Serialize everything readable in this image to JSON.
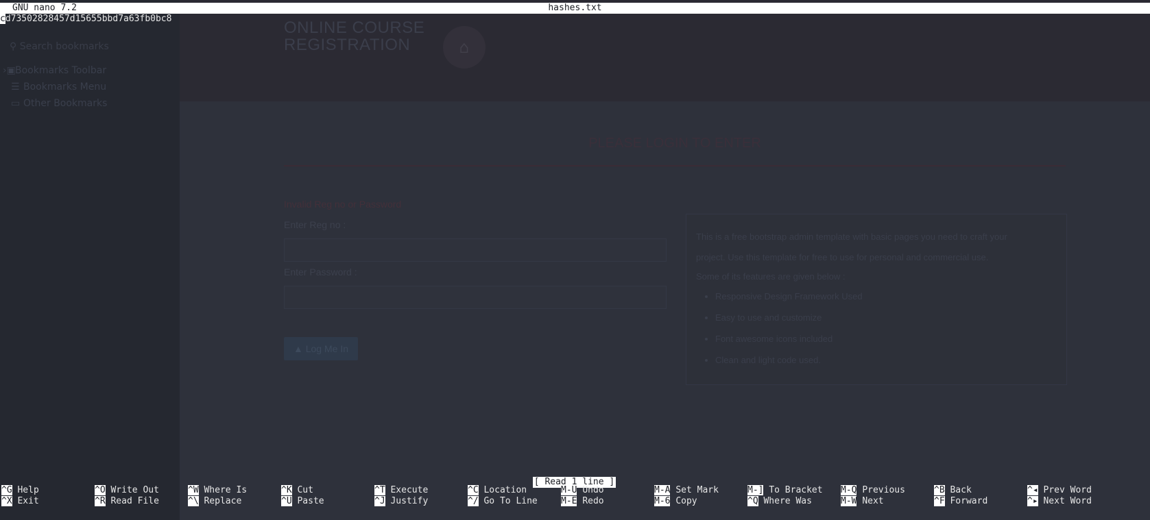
{
  "terminal": {
    "app_version": "GNU nano 7.2",
    "filename": "hashes.txt",
    "cursor_char": "c",
    "content_rest": "d73502828457d15655bbd7a63fb0bc8",
    "status_message": "[ Read 1 line ]"
  },
  "shortcuts": {
    "row1": [
      {
        "key": "^G",
        "label": "Help"
      },
      {
        "key": "^O",
        "label": "Write Out"
      },
      {
        "key": "^W",
        "label": "Where Is"
      },
      {
        "key": "^K",
        "label": "Cut"
      },
      {
        "key": "^T",
        "label": "Execute"
      },
      {
        "key": "^C",
        "label": "Location"
      },
      {
        "key": "M-U",
        "label": "Undo"
      },
      {
        "key": "M-A",
        "label": "Set Mark"
      },
      {
        "key": "M-]",
        "label": "To Bracket"
      },
      {
        "key": "M-Q",
        "label": "Previous"
      },
      {
        "key": "^B",
        "label": "Back"
      },
      {
        "key": "^◂",
        "label": "Prev Word"
      }
    ],
    "row2": [
      {
        "key": "^X",
        "label": "Exit"
      },
      {
        "key": "^R",
        "label": "Read File"
      },
      {
        "key": "^\\",
        "label": "Replace"
      },
      {
        "key": "^U",
        "label": "Paste"
      },
      {
        "key": "^J",
        "label": "Justify"
      },
      {
        "key": "^/",
        "label": "Go To Line"
      },
      {
        "key": "M-E",
        "label": "Redo"
      },
      {
        "key": "M-6",
        "label": "Copy"
      },
      {
        "key": "^Q",
        "label": "Where Was"
      },
      {
        "key": "M-W",
        "label": "Next"
      },
      {
        "key": "^F",
        "label": "Forward"
      },
      {
        "key": "^▸",
        "label": "Next Word"
      }
    ]
  },
  "background_page": {
    "bookmarks": {
      "search_placeholder": "Search bookmarks",
      "items": [
        "Bookmarks Toolbar",
        "Bookmarks Menu",
        "Other Bookmarks"
      ]
    },
    "site": {
      "brand_line1": "ONLINE COURSE",
      "brand_line2": "REGISTRATION",
      "login_title": "PLEASE LOGIN TO ENTER",
      "error_message": "Invalid Reg no or Password",
      "reg_label": "Enter Reg no :",
      "password_label": "Enter Password :",
      "login_button": "Log Me In",
      "info_line1": "This is a free bootstrap admin template with basic pages you need to craft your",
      "info_line2": "project. Use this template for free to use for personal and commercial use.",
      "info_line3": "Some of its features are given below :",
      "features": [
        "Responsive Design Framework Used",
        "Easy to use and customize",
        "Font awesome icons included",
        "Clean and light code used."
      ]
    }
  }
}
